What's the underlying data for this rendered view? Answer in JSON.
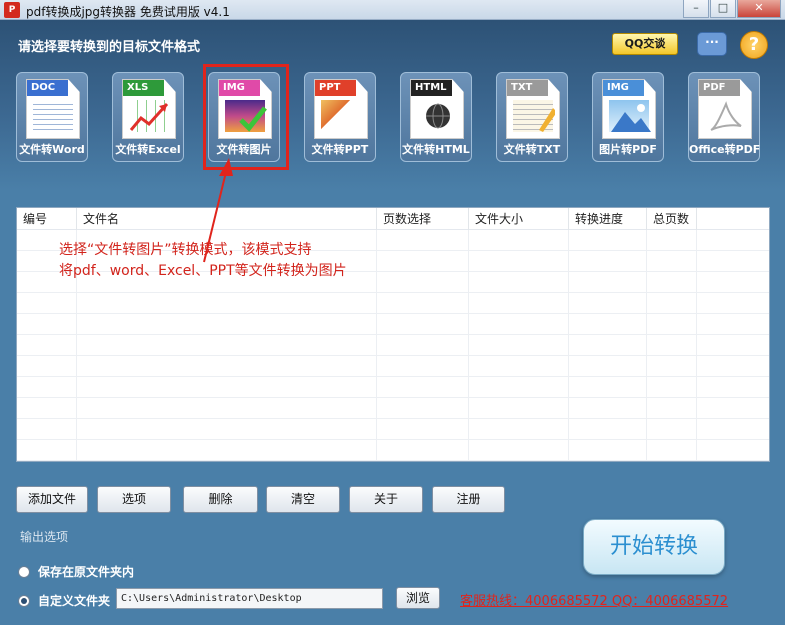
{
  "window": {
    "title": "pdf转换成jpg转换器 免费试用版 v4.1"
  },
  "header": {
    "label": "请选择要转换到的目标文件格式",
    "qq_label": "QQ交谈",
    "help_glyph": "?",
    "formats": [
      {
        "tag": "DOC",
        "label": "文件转Word",
        "color": "#3a6fd0"
      },
      {
        "tag": "XLS",
        "label": "文件转Excel",
        "color": "#2e9a3a"
      },
      {
        "tag": "IMG",
        "label": "文件转图片",
        "color": "#e04aa8"
      },
      {
        "tag": "PPT",
        "label": "文件转PPT",
        "color": "#e0402a"
      },
      {
        "tag": "HTML",
        "label": "文件转HTML",
        "color": "#222222"
      },
      {
        "tag": "TXT",
        "label": "文件转TXT",
        "color": "#9a9a9a"
      },
      {
        "tag": "IMG",
        "label": "图片转PDF",
        "color": "#4a8fd8"
      },
      {
        "tag": "PDF",
        "label": "Office转PDF",
        "color": "#9a9a9a"
      }
    ],
    "selected_index": 2
  },
  "table": {
    "columns": [
      "编号",
      "文件名",
      "页数选择",
      "文件大小",
      "转换进度",
      "总页数"
    ],
    "hint_line1": "选择“文件转图片”转换模式，该模式支持",
    "hint_line2": "将pdf、word、Excel、PPT等文件转换为图片"
  },
  "toolbar": {
    "add_file": "添加文件",
    "options": "选项",
    "delete": "删除",
    "clear": "清空",
    "about": "关于",
    "register": "注册"
  },
  "output": {
    "label": "输出选项",
    "option_original": "保存在原文件夹内",
    "option_custom": "自定义文件夹",
    "path_value": "C:\\Users\\Administrator\\Desktop",
    "browse": "浏览",
    "hotline": "客服热线：4006685572 QQ：4006685572",
    "start": "开始转换"
  },
  "colors": {
    "accent_red": "#e0241c",
    "start_blue": "#2b8fd0"
  }
}
